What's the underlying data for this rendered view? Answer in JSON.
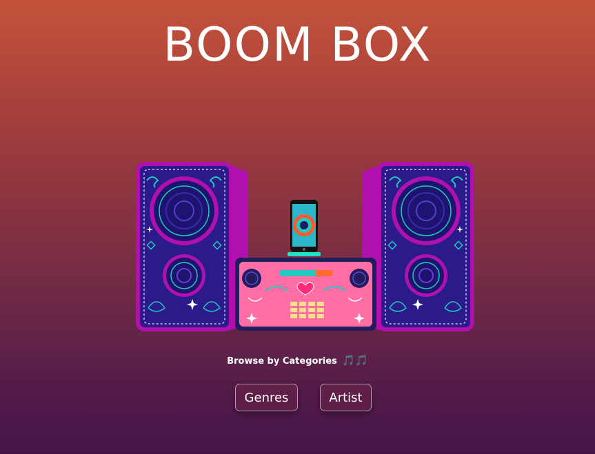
{
  "header": {
    "title": "BOOM BOX"
  },
  "hero": {
    "image": "boombox-illustration",
    "colors": {
      "speaker_body": "#2a1a8a",
      "speaker_side": "#b010b0",
      "ring": "#e030f0",
      "accent_teal": "#22c9c0",
      "center_unit": "#ff6fa6",
      "center_frame": "#241a5e",
      "eq_bars": "#ffe08a"
    }
  },
  "categories": {
    "label": "Browse by Categories",
    "note_icon": "music-notes-icon",
    "note_glyph": "🎵🎵",
    "buttons": [
      {
        "label": "Genres"
      },
      {
        "label": "Artist"
      }
    ]
  }
}
